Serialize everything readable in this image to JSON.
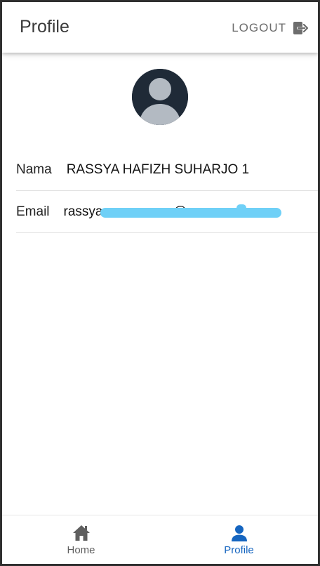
{
  "appbar": {
    "title": "Profile",
    "logout_label": "LOGOUT",
    "logout_icon": "logout-icon"
  },
  "profile": {
    "avatar_icon": "person-avatar-icon",
    "fields": [
      {
        "label": "Nama",
        "value": "RASSYA HAFIZH SUHARJO 1"
      },
      {
        "label": "Email",
        "value": "rassya.                  @"
      }
    ]
  },
  "bottom_nav": {
    "items": [
      {
        "label": "Home",
        "icon": "home-icon",
        "active": false
      },
      {
        "label": "Profile",
        "icon": "person-icon",
        "active": true
      }
    ]
  },
  "colors": {
    "active": "#1565c0",
    "inactive": "#5f5f5f",
    "avatar_bg": "#1f2a37",
    "redaction": "#6fd0f7"
  }
}
